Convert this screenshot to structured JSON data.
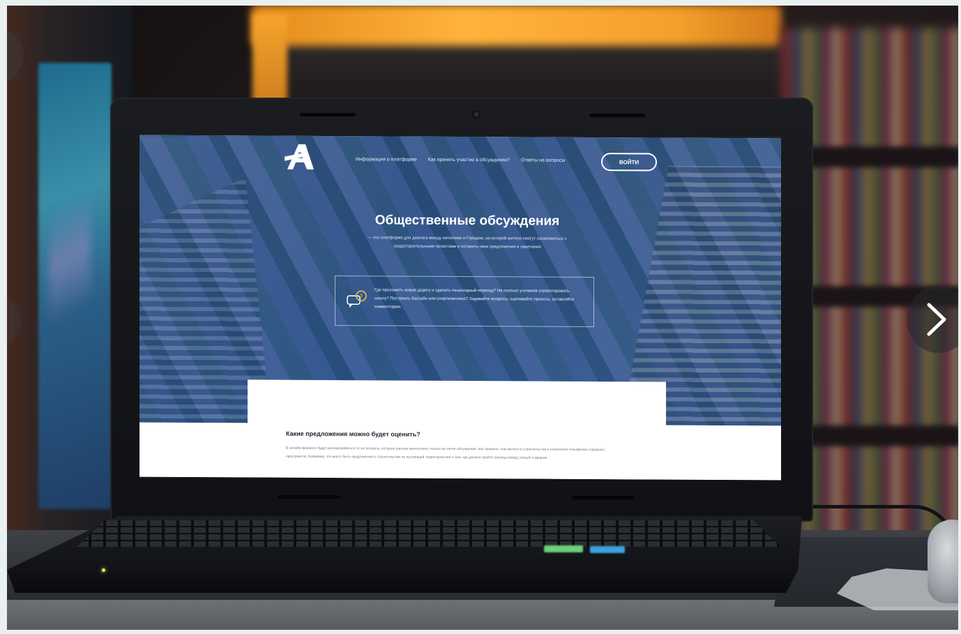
{
  "site": {
    "nav": [
      {
        "label": "Информация о платформе"
      },
      {
        "label": "Как принять участие в обсуждении?"
      },
      {
        "label": "Ответы на вопросы"
      }
    ],
    "login_label": "ВОЙТИ",
    "hero": {
      "title": "Общественные обсуждения",
      "subtitle": "— это платформа для диалога между жителями и Городом, на которой жители смогут ознакомиться с градостроительными проектами и оставить свои предложения и замечания"
    },
    "info_box": {
      "text": "Где проложить новую дорогу и сделать пешеходный переход? На сколько учеников спроектировать школу? Построить бассейн или спорткомплекс? Задавайте вопросы, оценивайте проекты, оставляйте комментарии."
    },
    "content": {
      "title": "Какие предложения можно будет оценить?",
      "text": "В онлайн-формате будут рассматриваться те же вопросы, которые раньше выносились только на очное обсуждение. Как правило, они касаются строительства и изменения планировки городских пространств. Например, это могут быть предложения о строительстве на пустующей территории или о том, где должна пройти граница между улицей и двором."
    }
  },
  "colors": {
    "hero_overlay": "#1c468c",
    "accent_orange": "#f5a02b",
    "frame": "#e8f1f0"
  },
  "icons": {
    "logo": "letter-a-logo-icon",
    "chat": "chat-bubbles-icon",
    "next": "chevron-right-icon"
  }
}
